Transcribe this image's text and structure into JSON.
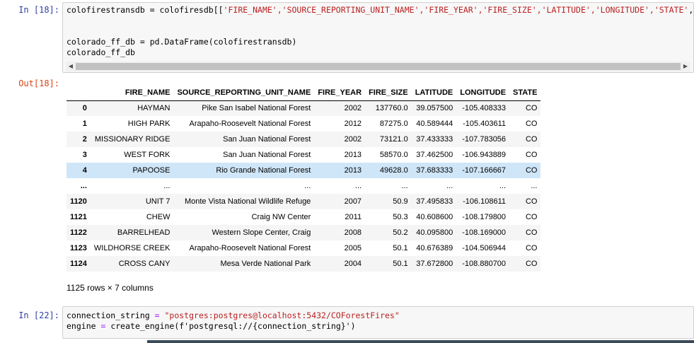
{
  "cells": {
    "in18": {
      "prompt": "In [18]:",
      "line1_a": "colofirestransdb = colofiresdb[[",
      "line1_b": "'FIRE_NAME','SOURCE_REPORTING_UNIT_NAME','FIRE_YEAR','FIRE_SIZE','LATITUDE','LONGITUDE','STATE'",
      "line1_c": ",",
      "line3_a": "colorado_ff_db = pd.DataFrame(colofirestransdb)",
      "line4": "colorado_ff_db"
    },
    "out18": {
      "prompt": "Out[18]:",
      "columns": [
        "FIRE_NAME",
        "SOURCE_REPORTING_UNIT_NAME",
        "FIRE_YEAR",
        "FIRE_SIZE",
        "LATITUDE",
        "LONGITUDE",
        "STATE"
      ],
      "rows": [
        {
          "index": "0",
          "cells": [
            "HAYMAN",
            "Pike San Isabel National Forest",
            "2002",
            "137760.0",
            "39.057500",
            "-105.408333",
            "CO"
          ]
        },
        {
          "index": "1",
          "cells": [
            "HIGH PARK",
            "Arapaho-Roosevelt National Forest",
            "2012",
            "87275.0",
            "40.589444",
            "-105.403611",
            "CO"
          ]
        },
        {
          "index": "2",
          "cells": [
            "MISSIONARY RIDGE",
            "San Juan National Forest",
            "2002",
            "73121.0",
            "37.433333",
            "-107.783056",
            "CO"
          ]
        },
        {
          "index": "3",
          "cells": [
            "WEST FORK",
            "San Juan National Forest",
            "2013",
            "58570.0",
            "37.462500",
            "-106.943889",
            "CO"
          ]
        },
        {
          "index": "4",
          "cells": [
            "PAPOOSE",
            "Rio Grande National Forest",
            "2013",
            "49628.0",
            "37.683333",
            "-107.166667",
            "CO"
          ],
          "highlight": true
        },
        {
          "index": "...",
          "cells": [
            "...",
            "...",
            "...",
            "...",
            "...",
            "...",
            "..."
          ]
        },
        {
          "index": "1120",
          "cells": [
            "UNIT 7",
            "Monte Vista National Wildlife Refuge",
            "2007",
            "50.9",
            "37.495833",
            "-106.108611",
            "CO"
          ]
        },
        {
          "index": "1121",
          "cells": [
            "CHEW",
            "Craig NW Center",
            "2011",
            "50.3",
            "40.608600",
            "-108.179800",
            "CO"
          ]
        },
        {
          "index": "1122",
          "cells": [
            "BARRELHEAD",
            "Western Slope Center, Craig",
            "2008",
            "50.2",
            "40.095800",
            "-108.169000",
            "CO"
          ]
        },
        {
          "index": "1123",
          "cells": [
            "WILDHORSE CREEK",
            "Arapaho-Roosevelt National Forest",
            "2005",
            "50.1",
            "40.676389",
            "-104.506944",
            "CO"
          ]
        },
        {
          "index": "1124",
          "cells": [
            "CROSS CANY",
            "Mesa Verde National Park",
            "2004",
            "50.1",
            "37.672800",
            "-108.880700",
            "CO"
          ]
        }
      ],
      "shape_text": "1125 rows × 7 columns"
    },
    "in22": {
      "prompt": "In [22]:",
      "line1_a": "connection_string ",
      "line1_op": "=",
      "line1_str": " \"postgres:postgres@localhost:5432/COForestFires\"",
      "line2_a": "engine ",
      "line2_op": "=",
      "line2_b": " create_engine(f'postgresql://{connection_string}')"
    }
  }
}
